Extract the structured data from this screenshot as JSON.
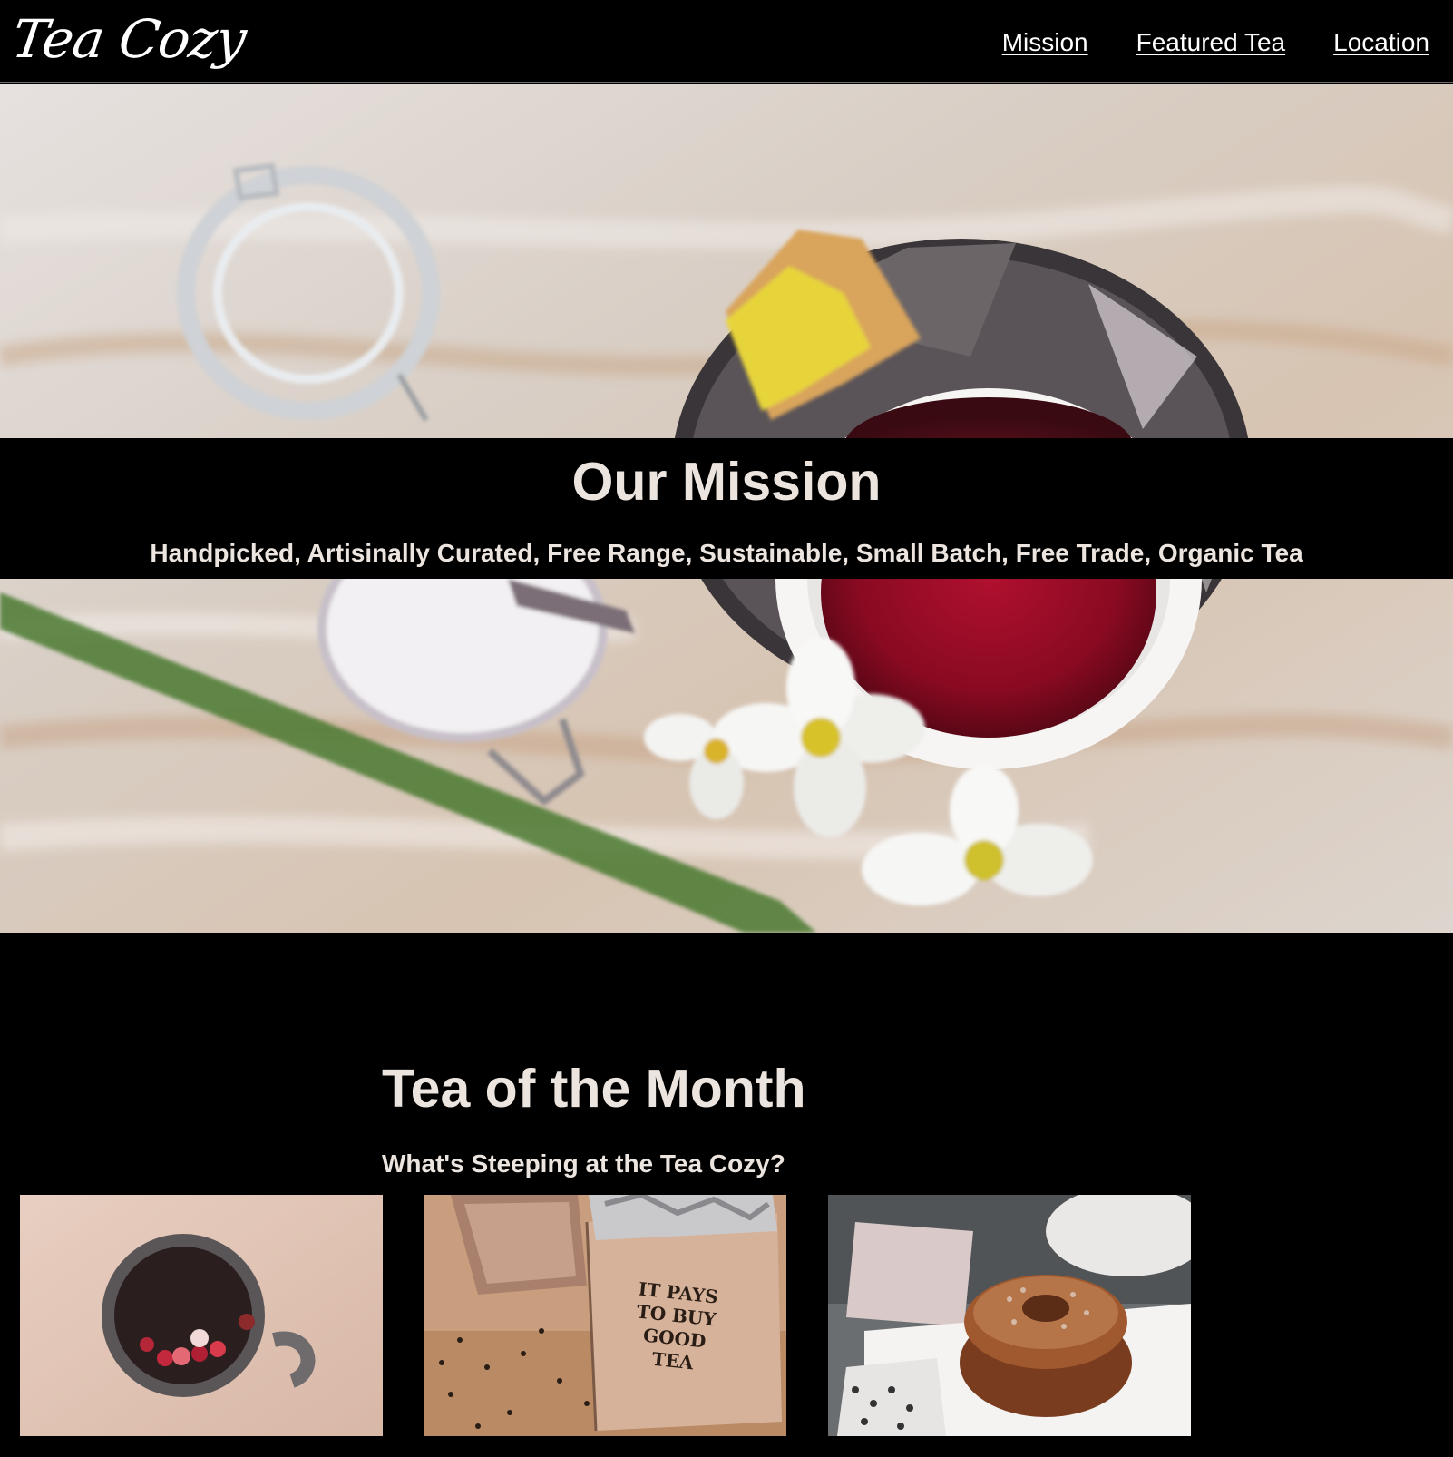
{
  "header": {
    "logo_text": "Tea Cozy",
    "nav": [
      {
        "label": "Mission"
      },
      {
        "label": "Featured Tea"
      },
      {
        "label": "Location"
      }
    ]
  },
  "mission": {
    "title": "Our Mission",
    "subtitle": "Handpicked, Artisinally Curated, Free Range, Sustainable, Small Batch, Free Trade, Organic Tea"
  },
  "featured": {
    "title": "Tea of the Month",
    "subtitle": "What's Steeping at the Tea Cozy?",
    "items": [
      {
        "image_label": "mug of berry tea"
      },
      {
        "image_label": "box of loose leaf tea",
        "box_text": [
          "IT PAYS",
          "TO BUY",
          "GOOD",
          "TEA"
        ]
      },
      {
        "image_label": "donut with powdered sugar"
      }
    ]
  }
}
